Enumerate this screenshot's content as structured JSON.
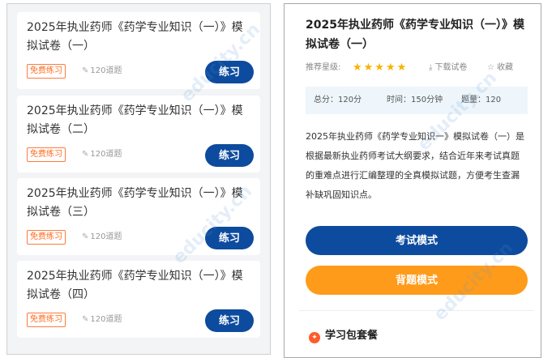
{
  "left_cards": [
    {
      "title": "2025年执业药师《药学专业知识（一）》模拟试卷（一）",
      "tag": "免费练习",
      "count": "120道题",
      "button": "练习"
    },
    {
      "title": "2025年执业药师《药学专业知识（一）》模拟试卷（二）",
      "tag": "免费练习",
      "count": "120道题",
      "button": "练习"
    },
    {
      "title": "2025年执业药师《药学专业知识（一）》模拟试卷（三）",
      "tag": "免费练习",
      "count": "120道题",
      "button": "练习"
    },
    {
      "title": "2025年执业药师《药学专业知识（一）》模拟试卷（四）",
      "tag": "免费练习",
      "count": "120道题",
      "button": "练习"
    }
  ],
  "detail": {
    "title": "2025年执业药师《药学专业知识（一）》模拟试卷（一）",
    "rating_label": "推荐星级:",
    "stars": "★★★★★",
    "download": "下载试卷",
    "favorite": "收藏",
    "total_score": "总分：120分",
    "time": "时间：150分钟",
    "questions": "题量：120",
    "description": "2025年执业药师《药学专业知识一》模拟试卷（一）是根据最新执业药师考试大纲要求，结合近年来考试真题的重难点进行汇编整理的全真模拟试题，方便考生查漏补缺巩固知识点。",
    "exam_mode": "考试模式",
    "recite_mode": "背题模式",
    "package_title": "学习包套餐"
  },
  "colors": {
    "primary": "#0d4b9e",
    "orange": "#ff9b1a",
    "tag": "#ff6a1f",
    "star": "#f6b400"
  },
  "icons": {
    "count": "pencil-icon",
    "download": "download-icon",
    "favorite": "star-outline-icon",
    "package": "flame-icon"
  }
}
